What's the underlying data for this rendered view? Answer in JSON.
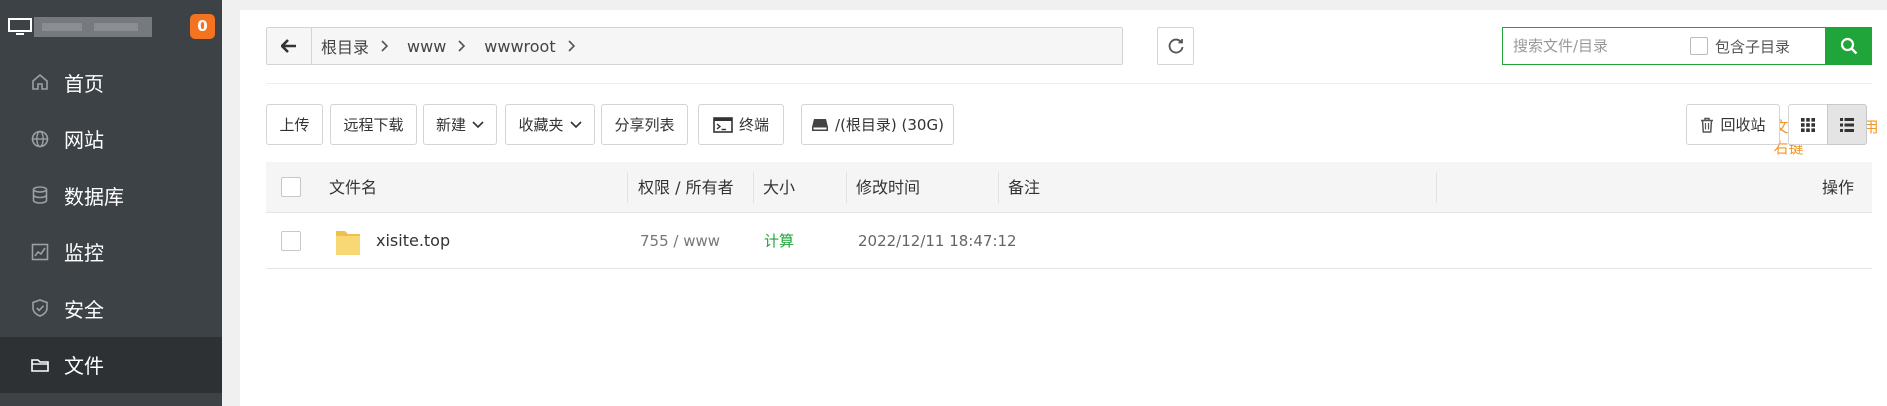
{
  "sidebar": {
    "badge": "0",
    "items": [
      {
        "label": "首页",
        "icon": "home-icon"
      },
      {
        "label": "网站",
        "icon": "globe-icon"
      },
      {
        "label": "数据库",
        "icon": "database-icon"
      },
      {
        "label": "监控",
        "icon": "monitor-chart-icon"
      },
      {
        "label": "安全",
        "icon": "shield-icon"
      },
      {
        "label": "文件",
        "icon": "folder-icon",
        "active": true
      }
    ]
  },
  "breadcrumb": [
    "根目录",
    "www",
    "wwwroot"
  ],
  "search": {
    "placeholder": "搜索文件/目录",
    "include_sub_label": "包含子目录"
  },
  "toolbar": {
    "upload": "上传",
    "remote_download": "远程下载",
    "new": "新建",
    "favorites": "收藏夹",
    "share_list": "分享列表",
    "terminal": "终端",
    "disk": "/(根目录) (30G)",
    "tip": "文件操作可使用右键",
    "recycle_bin": "回收站"
  },
  "table": {
    "headers": {
      "name": "文件名",
      "perm_owner": "权限 / 所有者",
      "size": "大小",
      "mtime": "修改时间",
      "remark": "备注",
      "actions": "操作"
    },
    "rows": [
      {
        "name": "xisite.top",
        "perm_owner": "755 / www",
        "size": "计算",
        "mtime": "2022/12/11 18:47:12",
        "remark": ""
      }
    ]
  },
  "colors": {
    "sidebar_bg": "#3d4246",
    "sidebar_active": "#2d3134",
    "accent_green": "#20a53a",
    "badge_orange": "#f5721f",
    "tip_orange": "#f0962a"
  }
}
